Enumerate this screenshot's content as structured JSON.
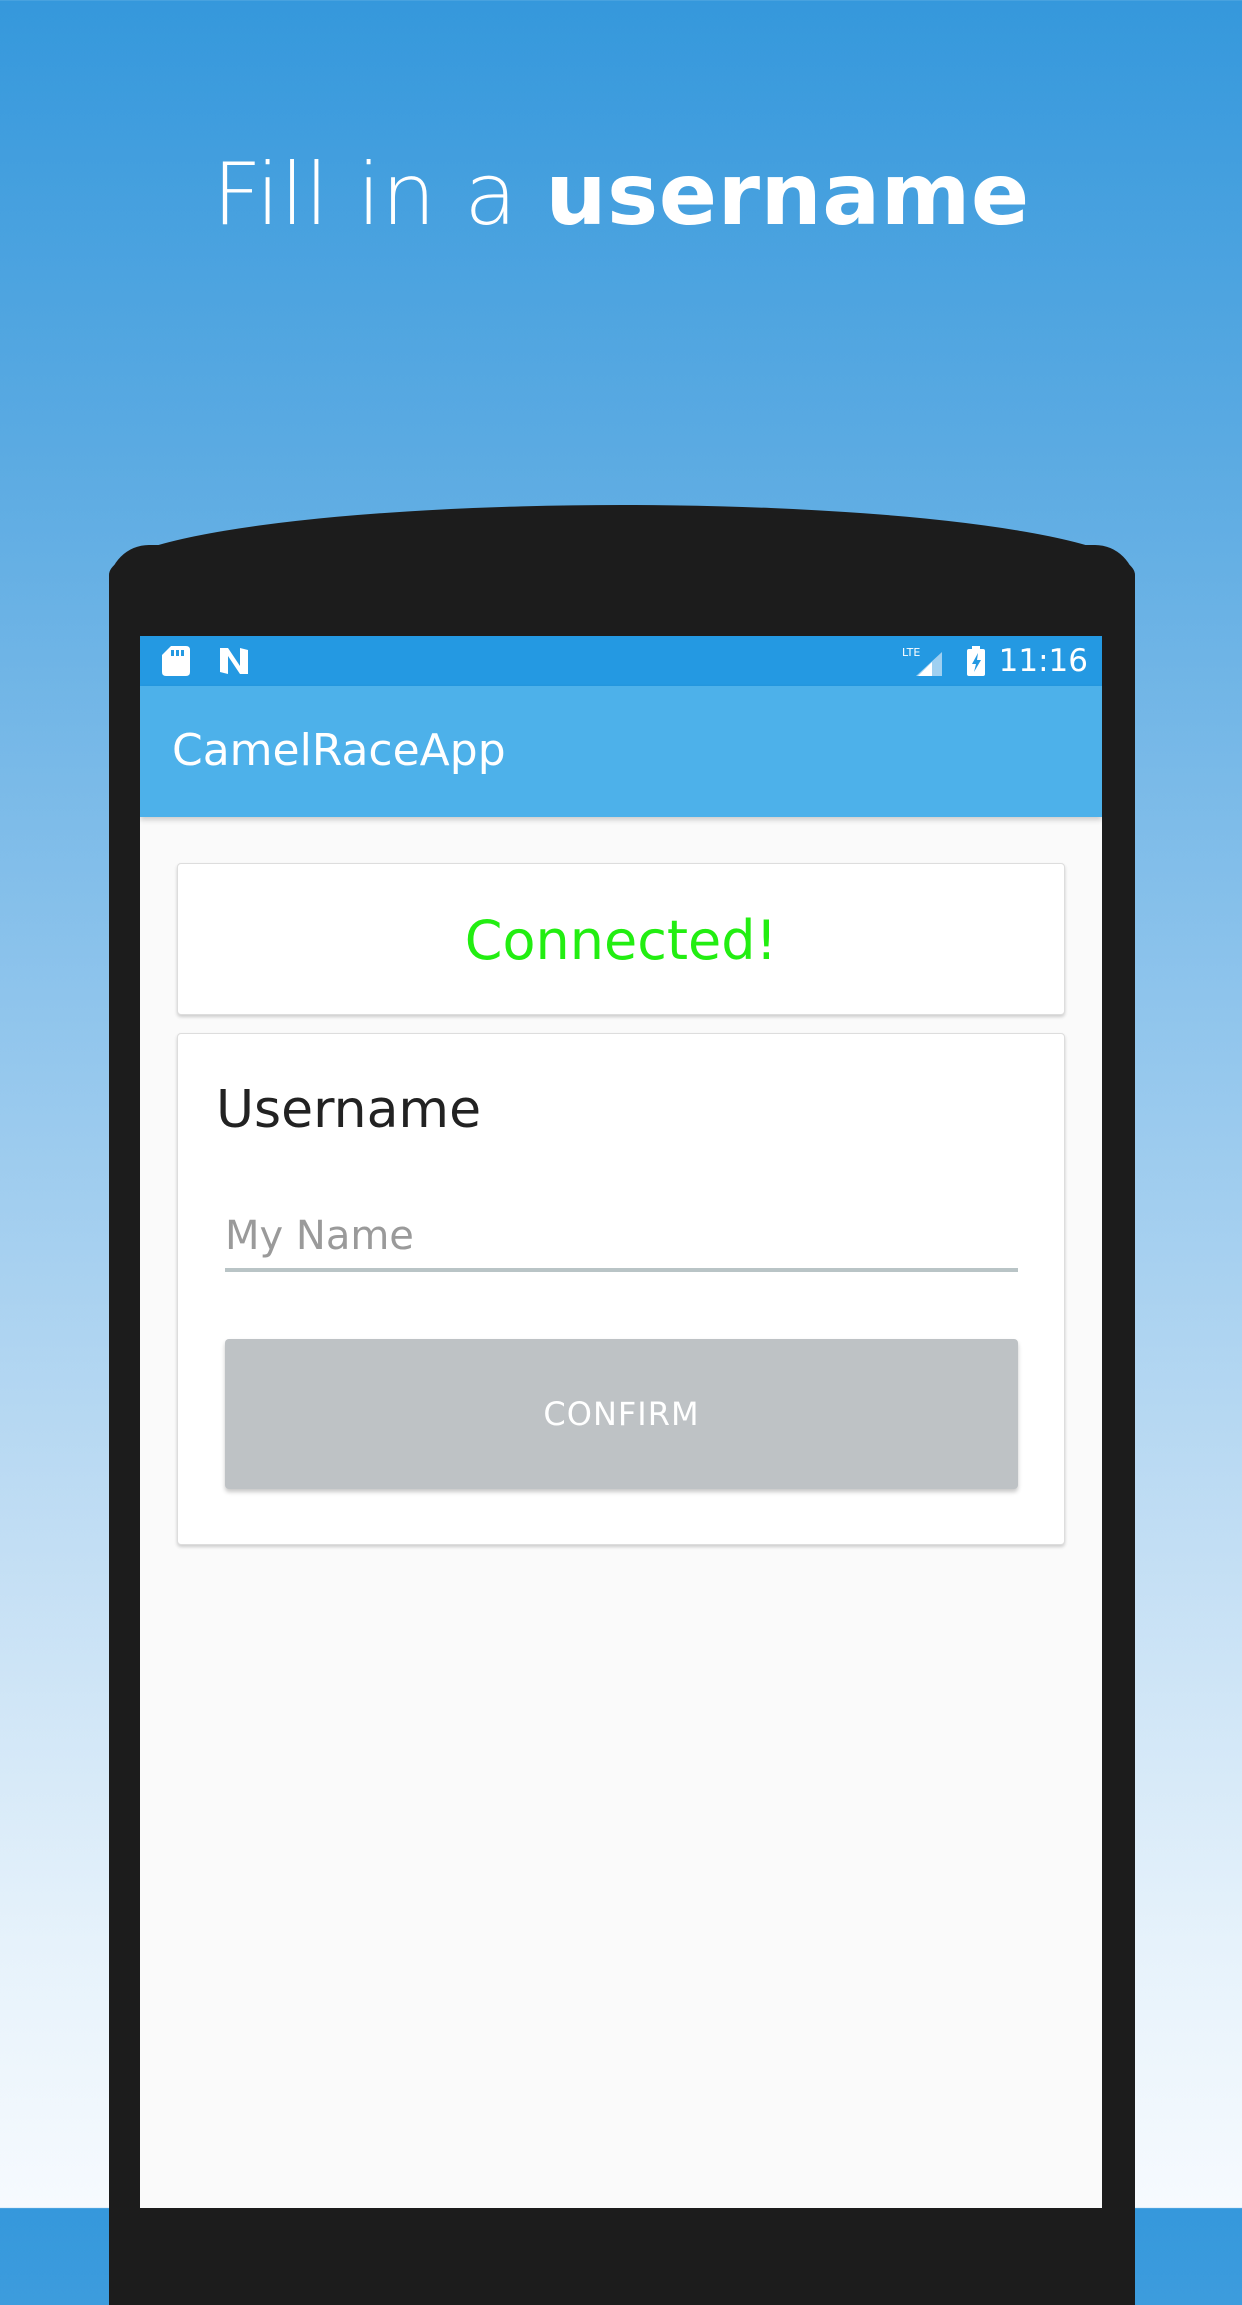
{
  "headline": {
    "prefix": "Fill in a ",
    "emphasis": "username"
  },
  "status_bar": {
    "time": "11:16",
    "network_label": "LTE",
    "icons": [
      "sd-card-icon",
      "n-notification-icon",
      "lte-signal-icon",
      "battery-charging-icon"
    ]
  },
  "app_bar": {
    "title": "CamelRaceApp"
  },
  "connection": {
    "status_text": "Connected!",
    "status_color": "#22ee11"
  },
  "username_form": {
    "label": "Username",
    "input_value": "",
    "input_placeholder": "My Name",
    "confirm_label": "CONFIRM"
  },
  "colors": {
    "status_bar": "#2499e2",
    "app_bar": "#4db1ea",
    "button_disabled": "#bec2c5",
    "phone_frame": "#1c1c1c"
  }
}
